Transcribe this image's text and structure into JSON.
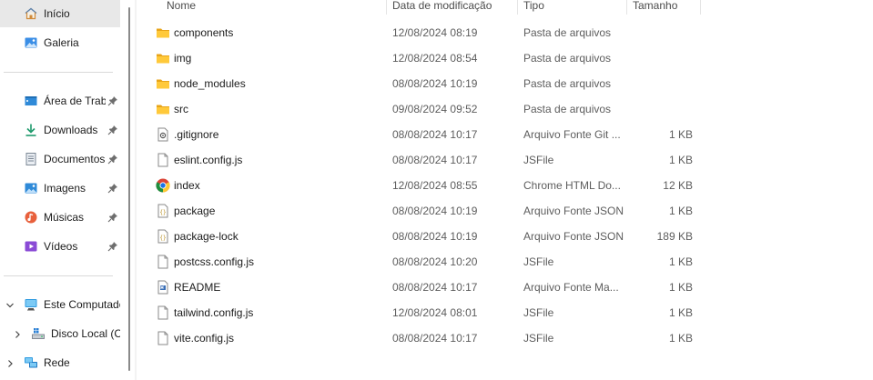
{
  "sidebar": {
    "home": {
      "label": "Início",
      "icon": "home-icon"
    },
    "gallery": {
      "label": "Galeria",
      "icon": "gallery-icon"
    },
    "quick_access": [
      {
        "label": "Área de Trabalho",
        "icon": "desktop-icon",
        "pinned": true
      },
      {
        "label": "Downloads",
        "icon": "download-icon",
        "pinned": true
      },
      {
        "label": "Documentos",
        "icon": "documents-icon",
        "pinned": true
      },
      {
        "label": "Imagens",
        "icon": "pictures-icon",
        "pinned": true
      },
      {
        "label": "Músicas",
        "icon": "music-icon",
        "pinned": true
      },
      {
        "label": "Vídeos",
        "icon": "videos-icon",
        "pinned": true
      }
    ],
    "this_pc": {
      "label": "Este Computador",
      "icon": "computer-icon",
      "expanded": true
    },
    "local_disk": {
      "label": "Disco Local (C:)",
      "icon": "disk-icon"
    },
    "network": {
      "label": "Rede",
      "icon": "network-icon"
    }
  },
  "columns": {
    "name": "Nome",
    "date": "Data de modificação",
    "type": "Tipo",
    "size": "Tamanho"
  },
  "files": [
    {
      "name": "components",
      "date": "12/08/2024 08:19",
      "type": "Pasta de arquivos",
      "size": "",
      "icon": "folder-icon"
    },
    {
      "name": "img",
      "date": "12/08/2024 08:54",
      "type": "Pasta de arquivos",
      "size": "",
      "icon": "folder-icon"
    },
    {
      "name": "node_modules",
      "date": "08/08/2024 10:19",
      "type": "Pasta de arquivos",
      "size": "",
      "icon": "folder-icon"
    },
    {
      "name": "src",
      "date": "09/08/2024 09:52",
      "type": "Pasta de arquivos",
      "size": "",
      "icon": "folder-icon"
    },
    {
      "name": ".gitignore",
      "date": "08/08/2024 10:17",
      "type": "Arquivo Fonte Git ...",
      "size": "1 KB",
      "icon": "settings-file-icon"
    },
    {
      "name": "eslint.config.js",
      "date": "08/08/2024 10:17",
      "type": "JSFile",
      "size": "1 KB",
      "icon": "file-icon"
    },
    {
      "name": "index",
      "date": "12/08/2024 08:55",
      "type": "Chrome HTML Do...",
      "size": "12 KB",
      "icon": "chrome-icon"
    },
    {
      "name": "package",
      "date": "08/08/2024 10:19",
      "type": "Arquivo Fonte JSON",
      "size": "1 KB",
      "icon": "json-file-icon"
    },
    {
      "name": "package-lock",
      "date": "08/08/2024 10:19",
      "type": "Arquivo Fonte JSON",
      "size": "189 KB",
      "icon": "json-file-icon"
    },
    {
      "name": "postcss.config.js",
      "date": "08/08/2024 10:20",
      "type": "JSFile",
      "size": "1 KB",
      "icon": "file-icon"
    },
    {
      "name": "README",
      "date": "08/08/2024 10:17",
      "type": "Arquivo Fonte Ma...",
      "size": "1 KB",
      "icon": "markdown-file-icon"
    },
    {
      "name": "tailwind.config.js",
      "date": "12/08/2024 08:01",
      "type": "JSFile",
      "size": "1 KB",
      "icon": "file-icon"
    },
    {
      "name": "vite.config.js",
      "date": "08/08/2024 10:17",
      "type": "JSFile",
      "size": "1 KB",
      "icon": "file-icon"
    }
  ]
}
